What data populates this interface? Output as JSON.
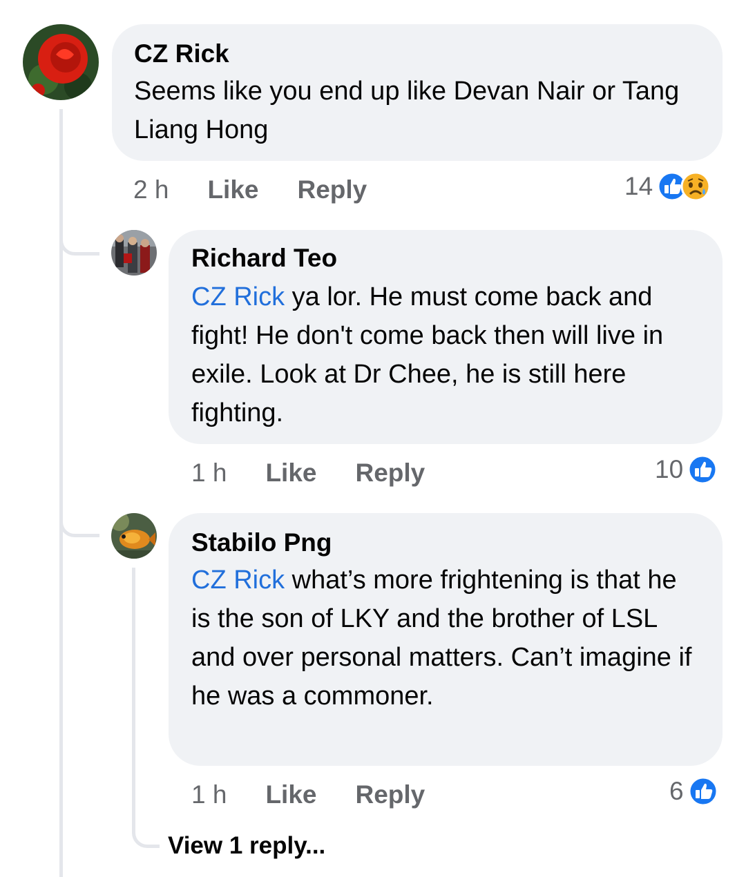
{
  "comments": [
    {
      "author": "CZ Rick",
      "text": "Seems like you end up like Devan Nair or Tang Liang Hong",
      "time": "2 h",
      "like_label": "Like",
      "reply_label": "Reply",
      "reaction_count": "14",
      "reactions": [
        "like-icon",
        "sad-icon"
      ],
      "avatar": "red-rose"
    },
    {
      "author": "Richard Teo",
      "mention": "CZ Rick",
      "text": " ya lor. He must come back and fight! He don't come back then will live in exile. Look at Dr Chee, he is still here fighting.",
      "time": "1 h",
      "like_label": "Like",
      "reply_label": "Reply",
      "reaction_count": "10",
      "reactions": [
        "like-icon"
      ],
      "avatar": "group-photo"
    },
    {
      "author": "Stabilo Png",
      "mention": "CZ Rick",
      "text": " what’s more frightening is that he is the son of LKY and the brother of LSL and over personal matters. Can’t imagine if he was a commoner.",
      "time": "1 h",
      "like_label": "Like",
      "reply_label": "Reply",
      "reaction_count": "6",
      "reactions": [
        "like-icon"
      ],
      "avatar": "fish"
    }
  ],
  "view_replies_label": "View 1 reply...",
  "colors": {
    "bubble": "#f0f2f5",
    "mention": "#216fdb",
    "meta": "#65676b",
    "like": "#1877f2",
    "sad": "#f7b125"
  }
}
